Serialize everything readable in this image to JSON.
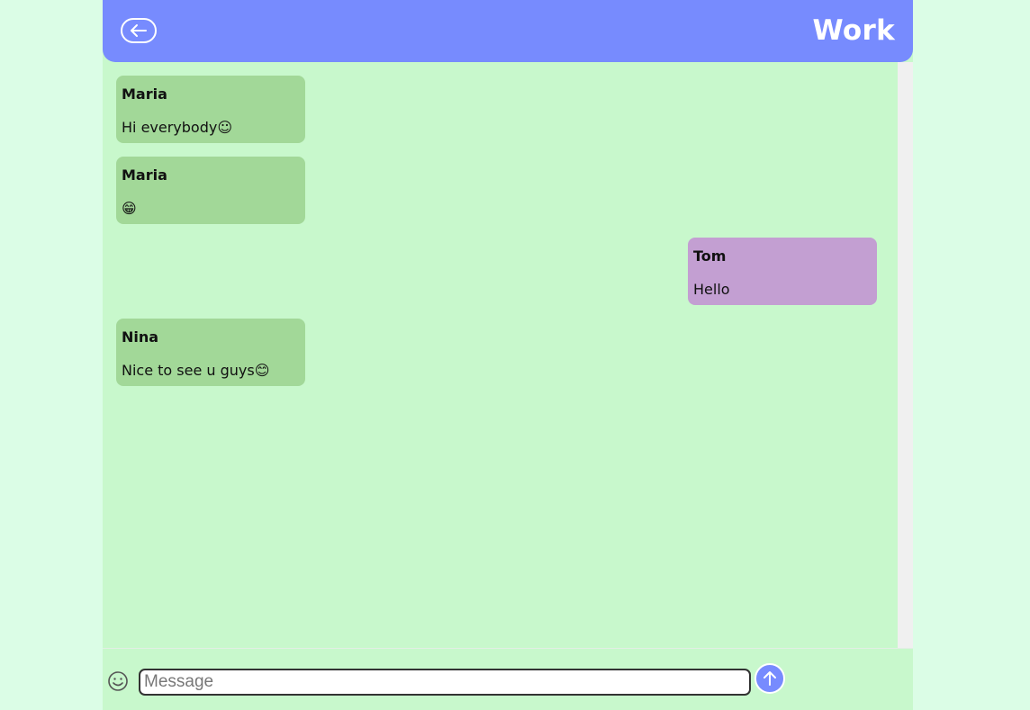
{
  "header": {
    "title": "Work",
    "back_icon": "back-arrow-icon"
  },
  "messages": [
    {
      "sender": "Maria",
      "text": "Hi everybody☺",
      "side": "other"
    },
    {
      "sender": "Maria",
      "text": "😁",
      "side": "other"
    },
    {
      "sender": "Tom",
      "text": "Hello",
      "side": "self"
    },
    {
      "sender": "Nina",
      "text": "Nice to see u guys😊",
      "side": "other"
    }
  ],
  "composer": {
    "placeholder": "Message",
    "value": "",
    "emoji_icon": "smiley-icon",
    "send_icon": "send-arrow-up-icon"
  },
  "colors": {
    "header": "#778bfe",
    "chat_background": "#c8f8cc",
    "page_background": "#dbfde6",
    "bubble_other": "#a2d898",
    "bubble_self": "#c39fd2"
  }
}
